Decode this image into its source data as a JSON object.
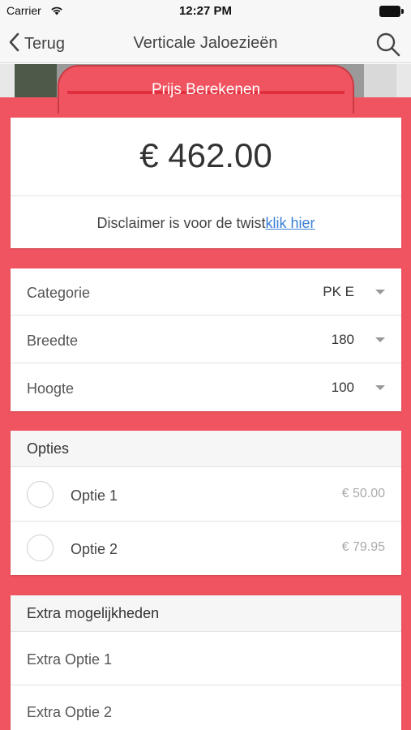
{
  "status_bar": {
    "carrier": "Carrier",
    "time": "12:27 PM",
    "wifi_icon": "wifi-icon",
    "battery_icon": "battery-icon"
  },
  "nav": {
    "back_label": "Terug",
    "back_icon": "chevron-left-icon",
    "title": "Verticale Jaloezieën",
    "search_icon": "search-icon"
  },
  "calc_tab": {
    "label": "Prijs Berekenen"
  },
  "price": {
    "value": "€ 462.00",
    "disclaimer_text": "Disclaimer is voor de twist",
    "disclaimer_link": "klik hier"
  },
  "selects": [
    {
      "label": "Categorie",
      "value": "PK E"
    },
    {
      "label": "Breedte",
      "value": "180"
    },
    {
      "label": "Hoogte",
      "value": "100"
    }
  ],
  "options": {
    "header": "Opties",
    "items": [
      {
        "label": "Optie 1",
        "price": "€ 50.00"
      },
      {
        "label": "Optie 2",
        "price": "€ 79.95"
      }
    ]
  },
  "extras": {
    "header": "Extra mogelijkheden",
    "items": [
      {
        "label": "Extra Optie 1"
      },
      {
        "label": "Extra Optie 2"
      }
    ]
  },
  "colors": {
    "accent": "#f05460",
    "link": "#3b7fd4"
  }
}
